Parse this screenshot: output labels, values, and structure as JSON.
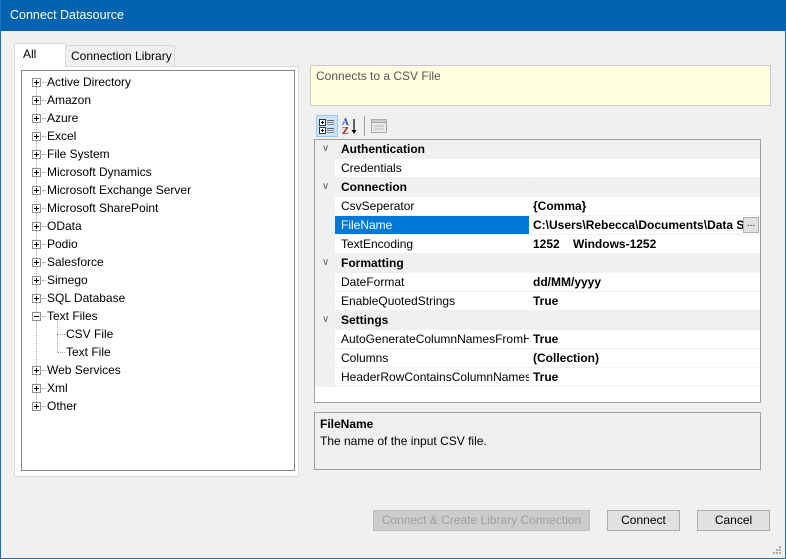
{
  "window": {
    "title": "Connect Datasource"
  },
  "tabs": [
    {
      "label": "All",
      "active": true
    },
    {
      "label": "Connection Library",
      "active": false
    }
  ],
  "tree": {
    "items": [
      {
        "label": "Active Directory",
        "expanded": false
      },
      {
        "label": "Amazon",
        "expanded": false
      },
      {
        "label": "Azure",
        "expanded": false
      },
      {
        "label": "Excel",
        "expanded": false
      },
      {
        "label": "File System",
        "expanded": false
      },
      {
        "label": "Microsoft Dynamics",
        "expanded": false
      },
      {
        "label": "Microsoft Exchange Server",
        "expanded": false
      },
      {
        "label": "Microsoft SharePoint",
        "expanded": false
      },
      {
        "label": "OData",
        "expanded": false
      },
      {
        "label": "Podio",
        "expanded": false
      },
      {
        "label": "Salesforce",
        "expanded": false
      },
      {
        "label": "Simego",
        "expanded": false
      },
      {
        "label": "SQL Database",
        "expanded": false
      },
      {
        "label": "Text Files",
        "expanded": true,
        "children": [
          {
            "label": "CSV File",
            "selected": true
          },
          {
            "label": "Text File"
          }
        ]
      },
      {
        "label": "Web Services",
        "expanded": false
      },
      {
        "label": "Xml",
        "expanded": false
      },
      {
        "label": "Other",
        "expanded": false
      }
    ]
  },
  "description": "Connects to a CSV File",
  "toolbar": {
    "categorized_icon": "categorized-view-icon",
    "alphabetical_icon": "sort-alphabetical-icon",
    "property_pages_icon": "property-pages-icon"
  },
  "property_grid": {
    "categories": [
      {
        "name": "Authentication",
        "properties": [
          {
            "name": "Credentials",
            "value": ""
          }
        ]
      },
      {
        "name": "Connection",
        "properties": [
          {
            "name": "CsvSeperator",
            "value": "{Comma}"
          },
          {
            "name": "FileName",
            "value": "C:\\Users\\Rebecca\\Documents\\Data Sy",
            "selected": true,
            "has_ellipsis": true
          },
          {
            "name": "TextEncoding",
            "value": "1252    Windows-1252"
          }
        ]
      },
      {
        "name": "Formatting",
        "properties": [
          {
            "name": "DateFormat",
            "value": "dd/MM/yyyy"
          },
          {
            "name": "EnableQuotedStrings",
            "value": "True"
          }
        ]
      },
      {
        "name": "Settings",
        "properties": [
          {
            "name": "AutoGenerateColumnNamesFromHeader",
            "value": "True"
          },
          {
            "name": "Columns",
            "value": "(Collection)"
          },
          {
            "name": "HeaderRowContainsColumnNames",
            "value": "True"
          }
        ]
      }
    ],
    "ellipsis_label": "..."
  },
  "help": {
    "title": "FileName",
    "text": "The name of the input CSV file."
  },
  "buttons": {
    "connect_library": "Connect & Create Library Connection",
    "connect": "Connect",
    "cancel": "Cancel"
  }
}
